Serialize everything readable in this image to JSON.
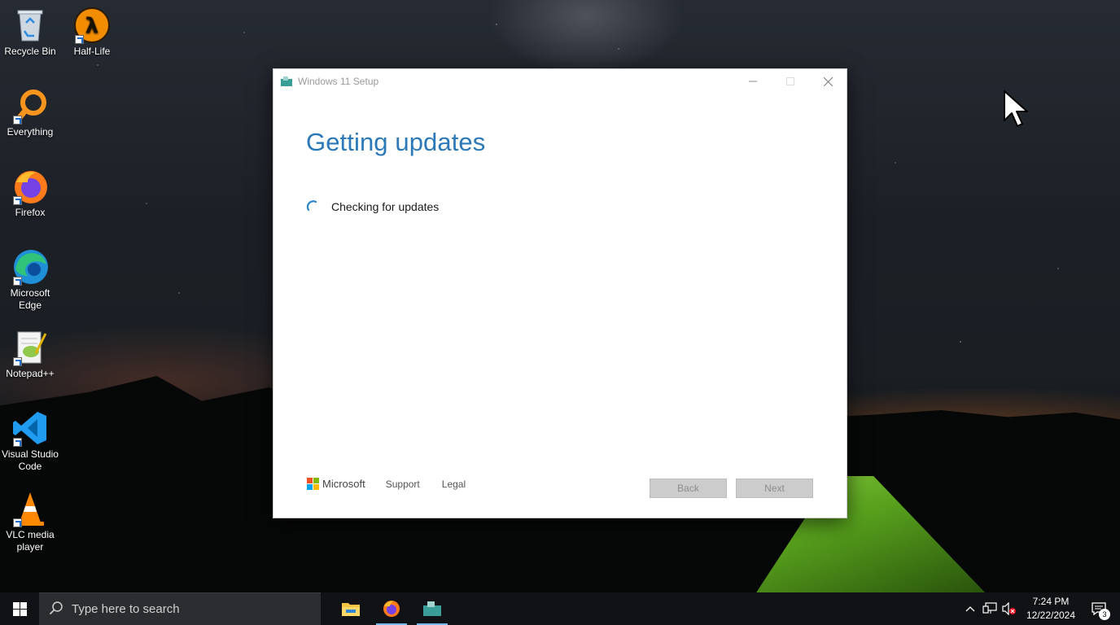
{
  "desktop": {
    "icons": [
      {
        "label": "Recycle Bin"
      },
      {
        "label": "Half-Life"
      },
      {
        "label": "Everything"
      },
      {
        "label": "Firefox"
      },
      {
        "label": "Microsoft Edge"
      },
      {
        "label": "Notepad++"
      },
      {
        "label": "Visual Studio Code"
      },
      {
        "label": "VLC media player"
      }
    ]
  },
  "window": {
    "title": "Windows 11 Setup",
    "heading": "Getting updates",
    "status": "Checking for updates",
    "footer": {
      "brand": "Microsoft",
      "support_label": "Support",
      "legal_label": "Legal",
      "back_label": "Back",
      "next_label": "Next"
    },
    "accent_color": "#2b79b8"
  },
  "taskbar": {
    "search_placeholder": "Type here to search",
    "apps": [
      "file-explorer",
      "firefox",
      "windows-11-setup"
    ],
    "time": "7:24 PM",
    "date": "12/22/2024",
    "notification_count": "3"
  }
}
